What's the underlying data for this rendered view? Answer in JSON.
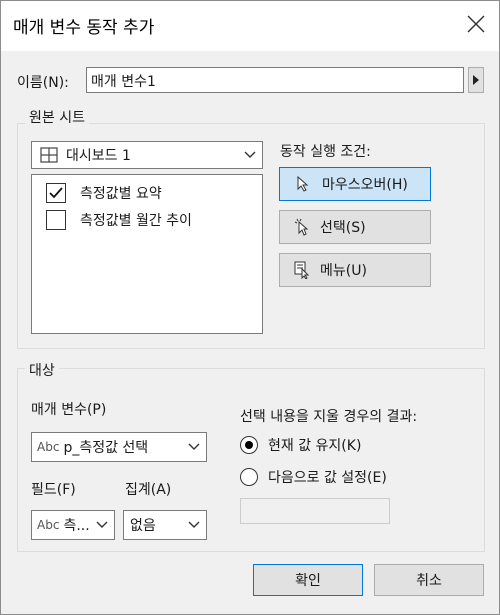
{
  "dialog": {
    "title": "매개 변수 동작 추가",
    "name_label": "이름(N):",
    "name_value": "매개 변수1",
    "source_sheets": {
      "group_label": "원본 시트",
      "dashboard_select": "대시보드 1",
      "sheets": [
        {
          "label": "측정값별 요약",
          "checked": true
        },
        {
          "label": "측정값별 월간 추이",
          "checked": false
        }
      ]
    },
    "run_condition": {
      "label": "동작 실행 조건:",
      "buttons": [
        {
          "label": "마우스오버(H)",
          "icon": "hover-pointer-icon",
          "selected": true
        },
        {
          "label": "선택(S)",
          "icon": "select-click-icon",
          "selected": false
        },
        {
          "label": "메뉴(U)",
          "icon": "menu-icon",
          "selected": false
        }
      ]
    },
    "target": {
      "group_label": "대상",
      "parameter_label": "매개 변수(P)",
      "parameter_value": "p_측정값 선택",
      "parameter_type": "Abc",
      "field_label": "필드(F)",
      "field_value": "측...",
      "field_type": "Abc",
      "aggregation_label": "집계(A)",
      "aggregation_value": "없음",
      "clear_label": "선택 내용을 지울 경우의 결과:",
      "clear_options": [
        {
          "label": "현재 값 유지(K)",
          "selected": true
        },
        {
          "label": "다음으로 값 설정(E)",
          "selected": false
        }
      ],
      "set_value": ""
    },
    "ok_label": "확인",
    "cancel_label": "취소"
  }
}
